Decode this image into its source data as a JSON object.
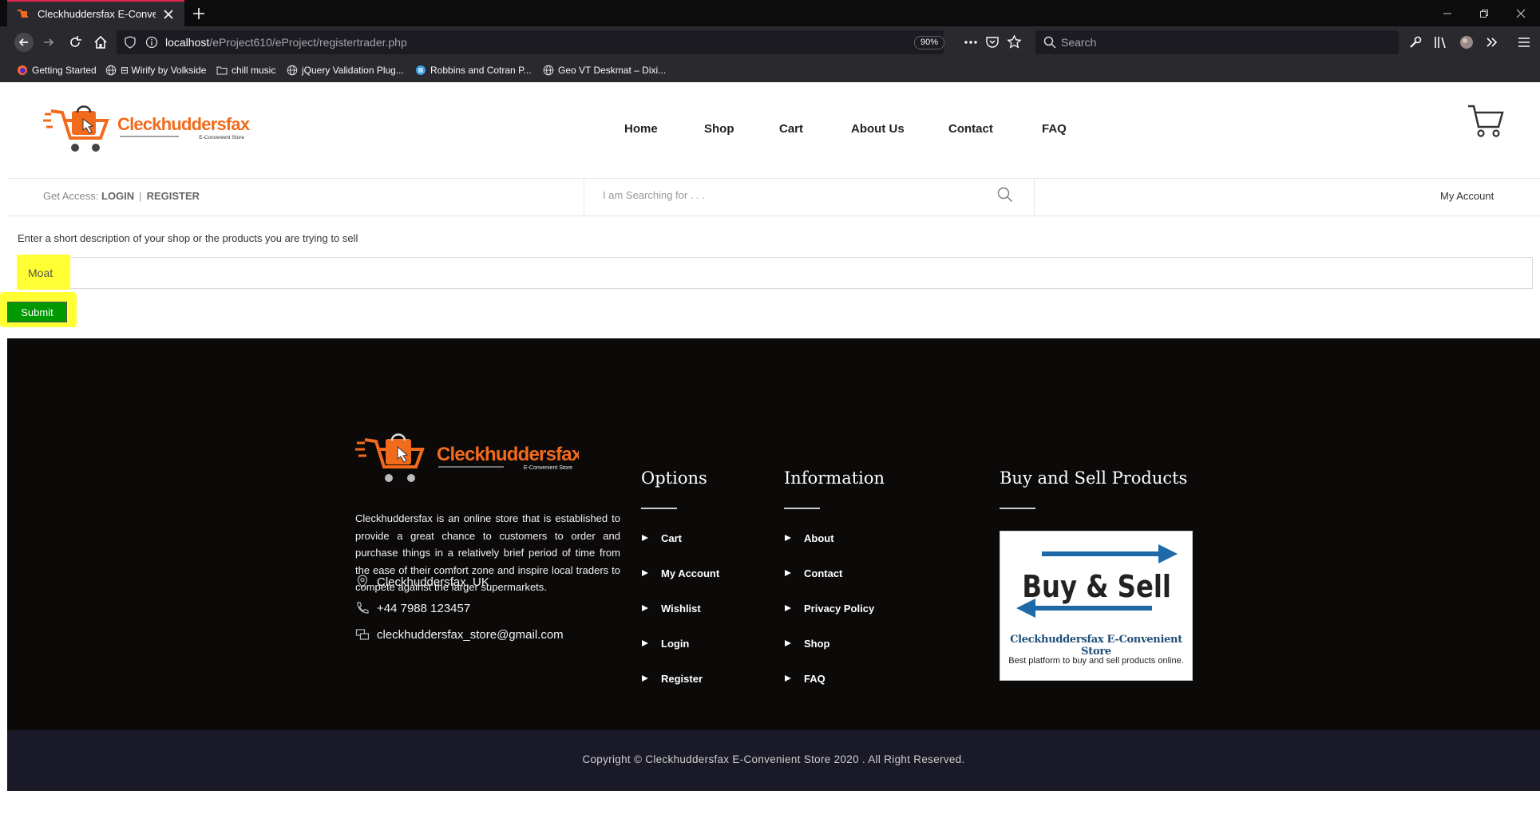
{
  "browser": {
    "tab_title": "Cleckhuddersfax E-Convenient",
    "url_host": "localhost",
    "url_path": "/eProject610/eProject/registertrader.php",
    "zoom": "90%",
    "search_placeholder": "Search",
    "bookmarks": [
      {
        "label": "Getting Started",
        "icon": "firefox-icon"
      },
      {
        "label": "⊟ Wirify by Volkside",
        "icon": "globe-icon"
      },
      {
        "label": "chill music",
        "icon": "folder-icon"
      },
      {
        "label": "jQuery Validation Plug...",
        "icon": "globe-icon"
      },
      {
        "label": "Robbins and Cotran P...",
        "icon": "blue-circle-icon"
      },
      {
        "label": "Geo VT Deskmat – Dixi...",
        "icon": "globe-icon"
      }
    ]
  },
  "brand": {
    "name": "Cleckhuddersfax",
    "tagline": "E-Convenient Store",
    "orange": "#f26b1d"
  },
  "nav": {
    "home": "Home",
    "shop": "Shop",
    "cart": "Cart",
    "about": "About Us",
    "contact": "Contact",
    "faq": "FAQ"
  },
  "subheader": {
    "access_label": "Get Access:",
    "login": "LOGIN",
    "register": "REGISTER",
    "search_placeholder": "I am Searching for . . .",
    "my_account": "My Account"
  },
  "form": {
    "prompt": "Enter a short description of your shop or the products you are trying to sell",
    "value": "Moat",
    "submit": "Submit",
    "highlight_color": "#ffff33",
    "submit_color": "#009900"
  },
  "footer": {
    "description": "Cleckhuddersfax is an online store that is established to provide a great chance to customers to order and purchase things in a relatively brief period of time from the ease of their comfort zone and inspire local traders to compete against the larger supermarkets.",
    "location": "Cleckhuddersfax, UK",
    "phone": "+44 7988 123457",
    "email": "cleckhuddersfax_store@gmail.com",
    "options_title": "Options",
    "options": [
      "Cart",
      "My Account",
      "Wishlist",
      "Login",
      "Register"
    ],
    "info_title": "Information",
    "info": [
      "About",
      "Contact",
      "Privacy Policy",
      "Shop",
      "FAQ"
    ],
    "buysell_title": "Buy and Sell Products",
    "buysell_img_main": "Buy & Sell",
    "buysell_img_title": "Cleckhuddersfax E-Convenient Store",
    "buysell_img_sub": "Best platform to buy and sell products online.",
    "copyright": "Copyright © Cleckhuddersfax E-Convenient Store 2020 . All Right Reserved."
  }
}
